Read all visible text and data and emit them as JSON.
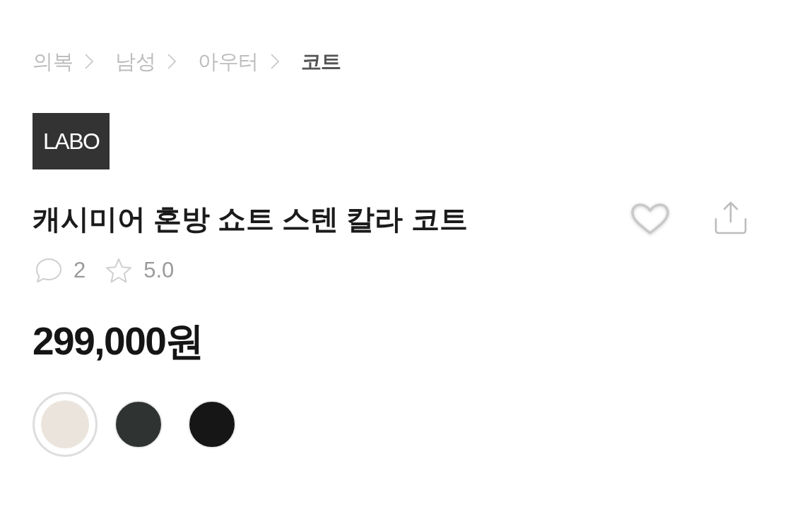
{
  "breadcrumb": [
    {
      "label": "의복",
      "current": false
    },
    {
      "label": "남성",
      "current": false
    },
    {
      "label": "아우터",
      "current": false
    },
    {
      "label": "코트",
      "current": true
    }
  ],
  "brand": {
    "label": "LABO"
  },
  "product": {
    "title": "캐시미어 혼방 쇼트 스텐 칼라 코트",
    "liked": false,
    "review_count": "2",
    "rating": "5.0"
  },
  "price": "299,000원",
  "colors": [
    {
      "color": "#ebe4dc",
      "selected": true
    },
    {
      "color": "#2f3433",
      "selected": false
    },
    {
      "color": "#161616",
      "selected": false
    }
  ]
}
